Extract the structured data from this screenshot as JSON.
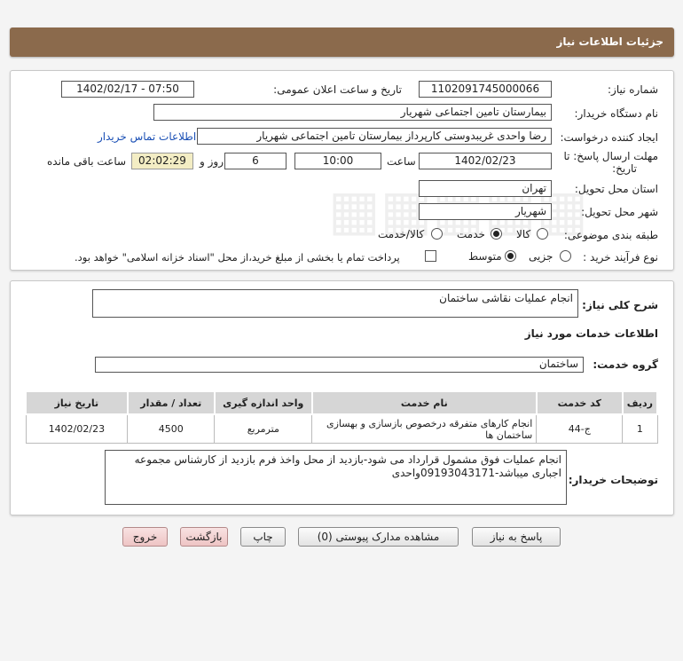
{
  "header": {
    "title": "جزئیات اطلاعات نیاز"
  },
  "fields": {
    "need_number_label": "شماره نیاز:",
    "need_number": "1102091745000066",
    "announce_label": "تاریخ و ساعت اعلان عمومی:",
    "announce_value": "1402/02/17 - 07:50",
    "buyer_org_label": "نام دستگاه خریدار:",
    "buyer_org": "بیمارستان تامین اجتماعی شهریار",
    "requester_label": "ایجاد کننده درخواست:",
    "requester": "رضا واحدی غریبدوستی کارپرداز بیمارستان تامین اجتماعی شهریار",
    "contact_link": "اطلاعات تماس خریدار",
    "deadline_label": "مهلت ارسال پاسخ: تا",
    "deadline_label2": "تاریخ:",
    "deadline_date": "1402/02/23",
    "time_label": "ساعت",
    "deadline_time": "10:00",
    "days_value": "6",
    "days_label": "روز و",
    "remaining_time": "02:02:29",
    "remaining_label": "ساعت باقی مانده",
    "province_label": "استان محل تحویل:",
    "province": "تهران",
    "city_label": "شهر محل تحویل:",
    "city": "شهریار",
    "category_label": "طبقه بندی موضوعی:",
    "category_options": [
      "کالا",
      "خدمت",
      "کالا/خدمت"
    ],
    "process_label": "نوع فرآیند خرید :",
    "process_options": [
      "جزیی",
      "متوسط"
    ],
    "payment_note": "پرداخت تمام یا بخشی از مبلغ خرید،از محل \"اسناد خزانه اسلامی\" خواهد بود."
  },
  "need": {
    "summary_label": "شرح کلی نیاز:",
    "summary": "انجام عملیات نقاشی ساختمان",
    "services_heading": "اطلاعات خدمات مورد نیاز",
    "service_group_label": "گروه خدمت:",
    "service_group": "ساختمان"
  },
  "table": {
    "headers": [
      "ردیف",
      "کد خدمت",
      "نام خدمت",
      "واحد اندازه گیری",
      "تعداد / مقدار",
      "تاریخ نیاز"
    ],
    "rows": [
      [
        "1",
        "ج-44",
        "انجام کارهای متفرقه درخصوص بازسازی و بهسازی ساختمان ها",
        "مترمربع",
        "4500",
        "1402/02/23"
      ]
    ]
  },
  "buyer_notes": {
    "label": "توضیحات خریدار:",
    "text": "انجام عملیات فوق مشمول قرارداد می شود-بازدید از محل واخذ فرم بازدید از کارشناس مجموعه اجباری میباشد-09193043171واحدی"
  },
  "buttons": {
    "reply": "پاسخ به نیاز",
    "attachments": "مشاهده مدارک پیوستی (0)",
    "print": "چاپ",
    "back": "بازگشت",
    "exit": "خروج"
  }
}
